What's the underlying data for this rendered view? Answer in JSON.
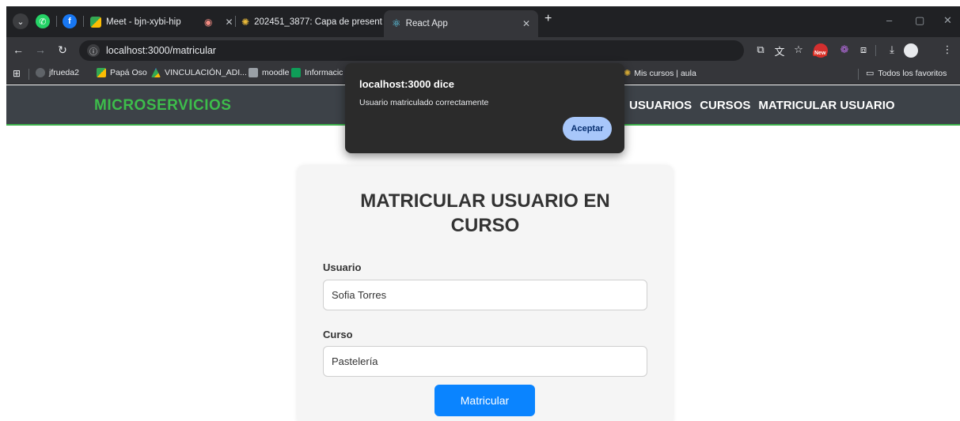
{
  "browser": {
    "tabs": [
      {
        "label": "Meet - bjn-xybi-hip"
      },
      {
        "label": "202451_3877: Capa de present"
      },
      {
        "label": "React App"
      }
    ],
    "url": "localhost:3000/matricular"
  },
  "bookmarks": [
    {
      "label": "jfrueda2"
    },
    {
      "label": "Papá Oso"
    },
    {
      "label": "VINCULACIÓN_ADI..."
    },
    {
      "label": "moodle"
    },
    {
      "label": "Informacic"
    },
    {
      "label": "Mis cursos | aula"
    },
    {
      "label": "Todos los favoritos"
    }
  ],
  "badge_new": "New",
  "app": {
    "brand": "MICROSERVICIOS",
    "nav": [
      "USUARIOS",
      "CURSOS",
      "MATRICULAR USUARIO"
    ]
  },
  "form": {
    "title_line1": "MATRICULAR USUARIO EN",
    "title_line2": "CURSO",
    "user_label": "Usuario",
    "user_value": "Sofia Torres",
    "course_label": "Curso",
    "course_value": "Pastelería",
    "submit_label": "Matricular"
  },
  "alert": {
    "title": "localhost:3000 dice",
    "message": "Usuario matriculado correctamente",
    "button": "Aceptar"
  },
  "colors": {
    "brand": "#3dbd4b",
    "navbar": "#3d4248",
    "primary_button": "#0a84ff",
    "dialog_button": "#a8c7fa"
  }
}
